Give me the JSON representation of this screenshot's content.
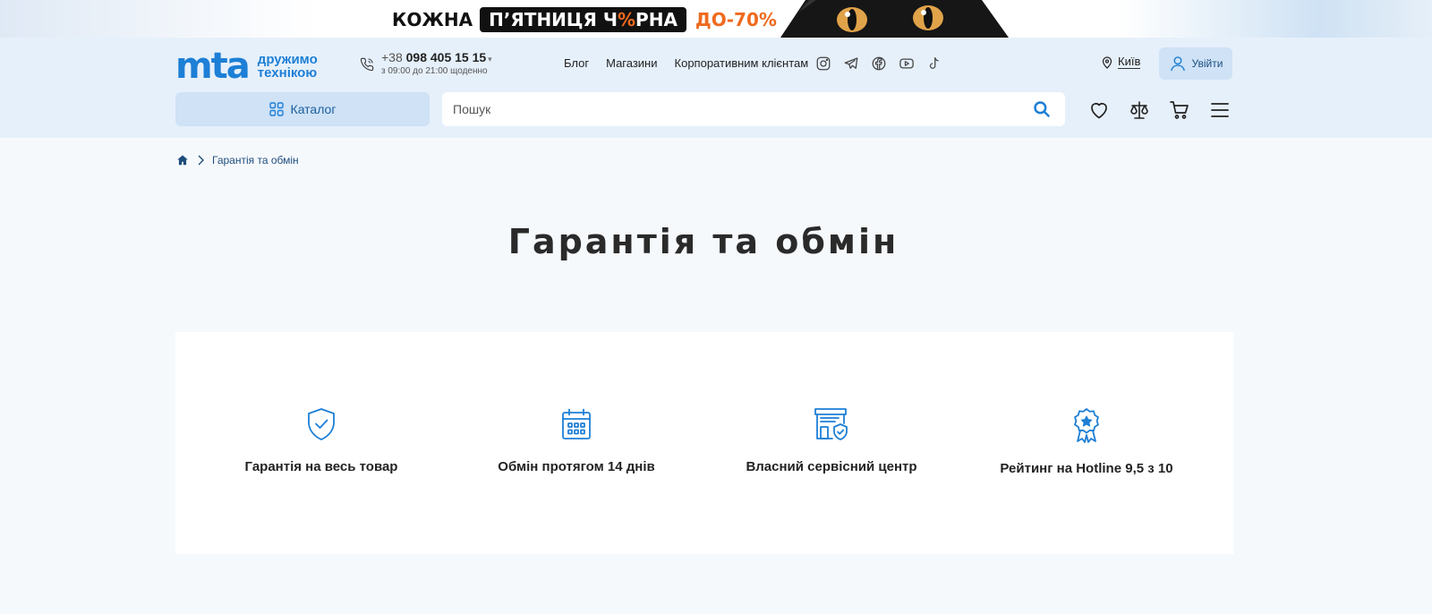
{
  "promo": {
    "kozhna": "КОЖНА",
    "black_pre": "П’ЯТНИЦЯ Ч",
    "black_pct": "%",
    "black_post": "РНА",
    "sale": "ДО-70%"
  },
  "header": {
    "logo": {
      "mark": "mta",
      "tag_line1": "дружимо",
      "tag_line2": "технікою"
    },
    "phone": {
      "prefix": "+38",
      "number": "098 405 15 15",
      "caret": "▾",
      "hours": "з 09:00 до 21:00 щоденно"
    },
    "nav": [
      "Блог",
      "Магазини",
      "Корпоративним клієнтам"
    ],
    "socials": [
      "instagram-icon",
      "telegram-icon",
      "facebook-icon",
      "youtube-icon",
      "tiktok-icon"
    ],
    "city": "Київ",
    "login": "Увійти",
    "catalog": "Каталог",
    "search": {
      "placeholder": "Пошук",
      "value": ""
    },
    "actions": [
      "heart-icon",
      "compare-scales-icon",
      "cart-icon",
      "menu-icon"
    ]
  },
  "breadcrumb": {
    "current": "Гарантія та обмін"
  },
  "page": {
    "title": "Гарантія та обмін"
  },
  "features": [
    {
      "icon": "shield-check-icon",
      "label": "Гарантія на весь товар"
    },
    {
      "icon": "calendar-icon",
      "label": "Обмін протягом 14 днів"
    },
    {
      "icon": "service-center-icon",
      "label": "Власний сервісний центр"
    },
    {
      "icon": "award-badge-icon",
      "label": "Рейтинг на Hotline 9,5 з 10"
    }
  ],
  "colors": {
    "brand": "#1d7fd6",
    "header_bg": "#e6f0fb",
    "page_bg": "#f6f9fc",
    "promo_accent": "#ef6a1f"
  }
}
